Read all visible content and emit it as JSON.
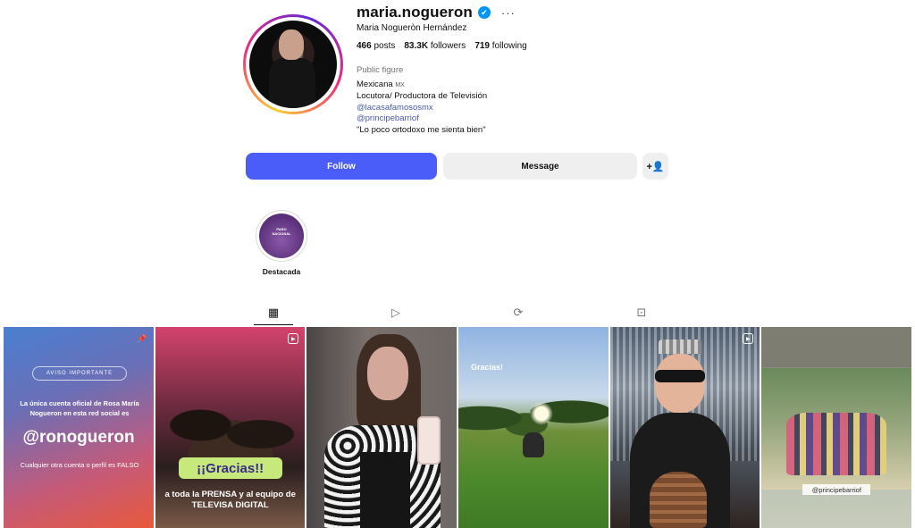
{
  "profile": {
    "username": "maria.nogueron",
    "full_name": "Maria Nogueròn Hernández",
    "verified_icon": "✔",
    "more_icon": "···",
    "stats": {
      "posts_count": "466",
      "posts_label": "posts",
      "followers_count": "83.3K",
      "followers_label": "followers",
      "following_count": "719",
      "following_label": "following"
    },
    "bio": {
      "category": "Public figure",
      "line1": "Mexicana",
      "line1_suffix": "MX",
      "line2": "Locutora/ Productora de Televisión",
      "link1": "@lacasafamososmx",
      "link2": "@principebarriof",
      "line3": "\"Lo poco ortodoxo me sienta bien\""
    }
  },
  "actions": {
    "follow_label": "Follow",
    "message_label": "Message",
    "add_user_icon": "+👤"
  },
  "highlights": [
    {
      "label": "Destacada",
      "thumb_text": "PARO NACIONAL"
    }
  ],
  "tabs": {
    "posts_icon": "▦",
    "reels_icon": "▷",
    "reposts_icon": "⟳",
    "tagged_icon": "⊡"
  },
  "posts": {
    "p1": {
      "notice": "AVISO IMPORTANTE",
      "line1": "La única cuenta oficial de Rosa María Nogueron en esta red social es",
      "handle": "@ronogueron",
      "line2": "Cualquier otra cuenta o perfil es FALSO",
      "badge": "📌"
    },
    "p2": {
      "thanks": "¡¡Gracias!!",
      "caption": "a toda la PRENSA y al equipo de TELEVISA DIGITAL",
      "badge": "▶"
    },
    "p4": {
      "text": "Gracias!"
    },
    "p5": {
      "badge": "▶"
    },
    "p6": {
      "tag": "@principebarriof"
    }
  }
}
